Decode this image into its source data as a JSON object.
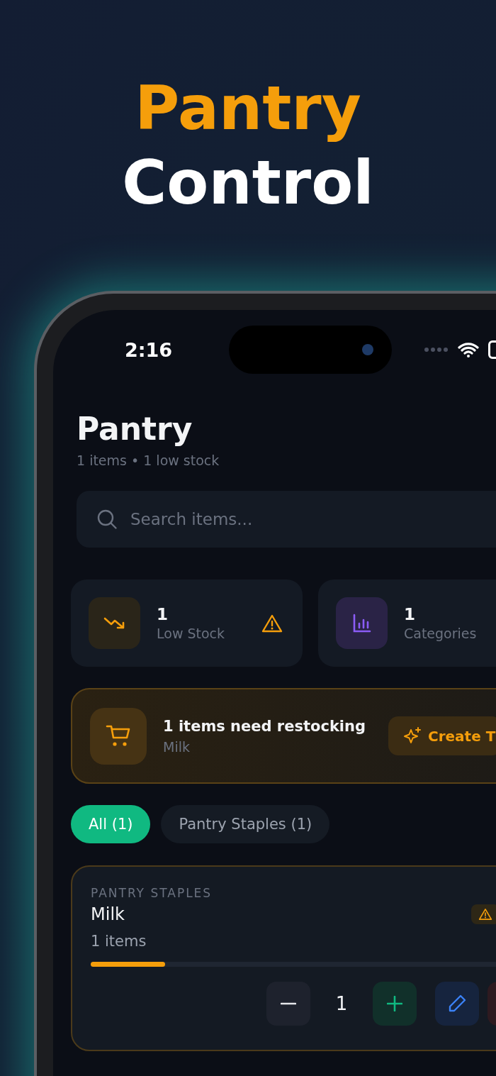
{
  "headline": {
    "line_1": "Pantry",
    "line_2": "Control"
  },
  "status_bar": {
    "time": "2:16"
  },
  "header": {
    "title": "Pantry",
    "subtitle": "1 items • 1 low stock"
  },
  "search": {
    "placeholder": "Search items..."
  },
  "stats": [
    {
      "kind": "low_stock",
      "value": "1",
      "label": "Low Stock"
    },
    {
      "kind": "categories",
      "value": "1",
      "label": "Categories"
    }
  ],
  "restock_banner": {
    "title": "1 items need restocking",
    "items": "Milk",
    "button": "Create T"
  },
  "filters": [
    {
      "label": "All (1)",
      "selected": true
    },
    {
      "label": "Pantry Staples (1)",
      "selected": false
    }
  ],
  "items": [
    {
      "category": "PANTRY STAPLES",
      "name": "Milk",
      "count": "1 items",
      "low_stock": true,
      "level": 0.18,
      "quantity": "1"
    }
  ]
}
